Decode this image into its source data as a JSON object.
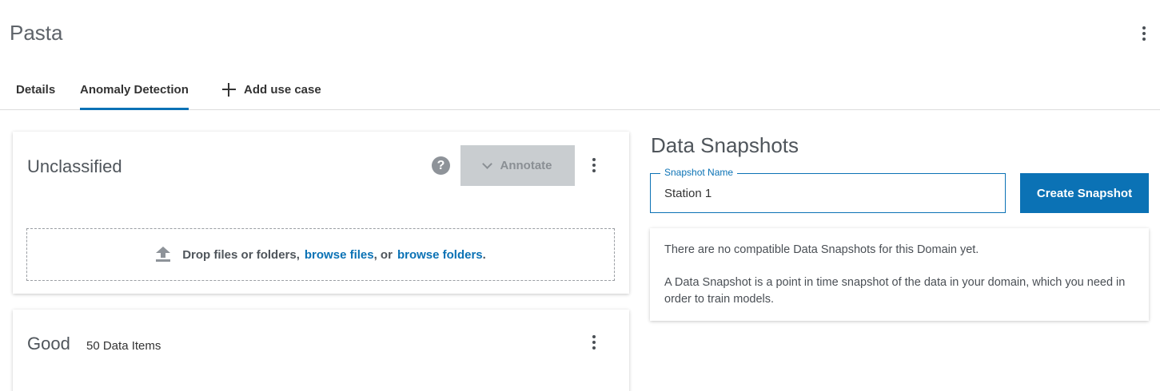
{
  "header": {
    "title": "Pasta",
    "menu_icon": "kebab-vertical-icon"
  },
  "tabs": [
    {
      "label": "Details",
      "active": false
    },
    {
      "label": "Anomaly Detection",
      "active": true
    },
    {
      "label": "Add use case",
      "icon": "plus-icon",
      "active": false
    }
  ],
  "unclassified": {
    "title": "Unclassified",
    "help_icon": "?",
    "annotate_label": "Annotate",
    "dropzone": {
      "prefix": "Drop files or folders,",
      "browse_files": "browse files",
      "middle": ", or",
      "browse_folders": "browse folders",
      "suffix": "."
    }
  },
  "good": {
    "title": "Good",
    "count": "50 Data Items"
  },
  "snapshots": {
    "title": "Data Snapshots",
    "field_label": "Snapshot Name",
    "field_value": "Station 1",
    "create_label": "Create Snapshot",
    "empty_message": "There are no compatible Data Snapshots for this Domain yet.",
    "description": "A Data Snapshot is a point in time snapshot of the data in your domain, which you need in order to train models."
  },
  "colors": {
    "accent": "#0b72b5",
    "disabled_button": "#c9cdd0"
  }
}
